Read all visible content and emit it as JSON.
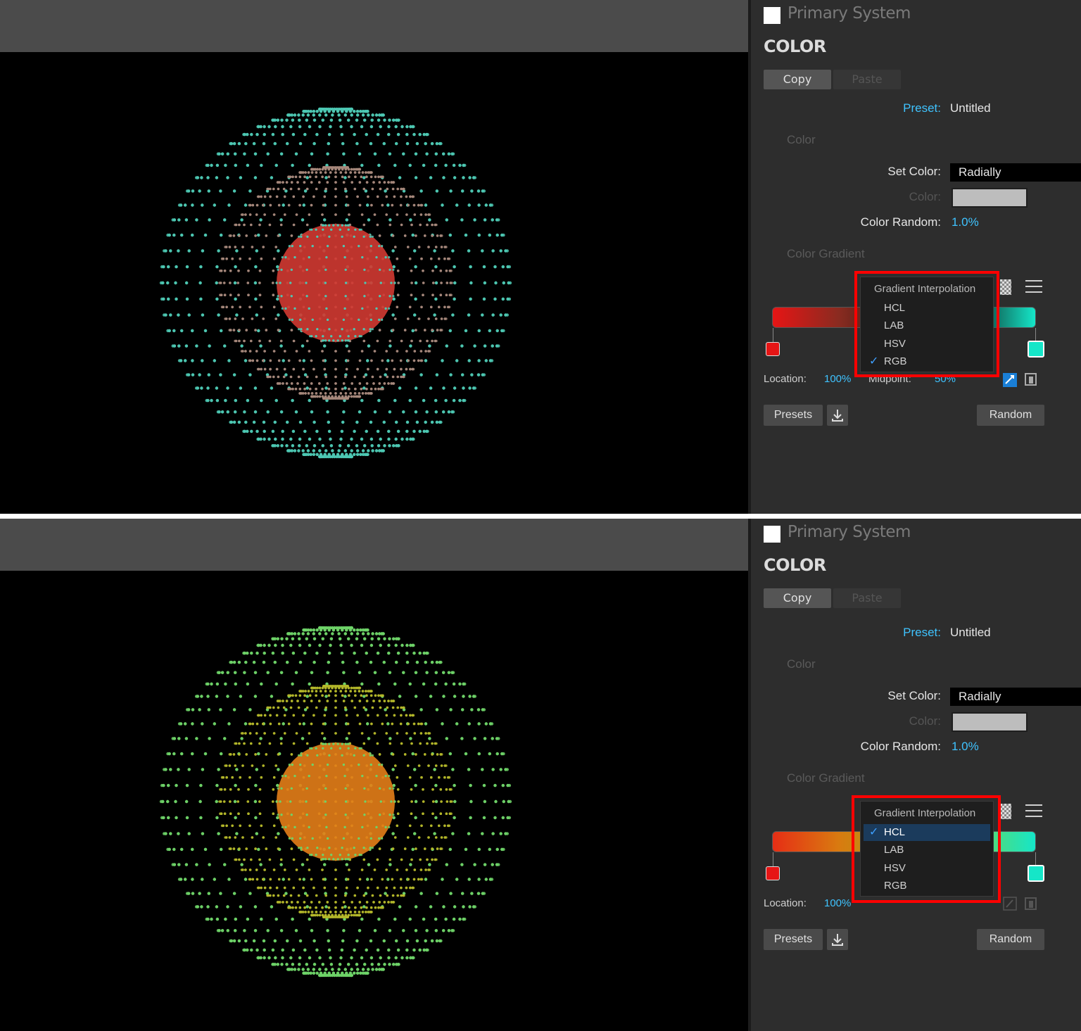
{
  "panels": [
    {
      "system_title": "Primary System",
      "section_title": "COLOR",
      "copy_label": "Copy",
      "paste_label": "Paste",
      "preset_label": "Preset:",
      "preset_value": "Untitled",
      "color_group_title": "Color",
      "set_color_label": "Set Color:",
      "set_color_value": "Radially",
      "color_label": "Color:",
      "color_random_label": "Color Random:",
      "color_random_value": "1.0%",
      "gradient_group_title": "Color Gradient",
      "dropdown_title": "Gradient Interpolation",
      "interpolation_options": [
        "HCL",
        "LAB",
        "HSV",
        "RGB"
      ],
      "selected_interpolation": "RGB",
      "location_label": "Location:",
      "location_value": "100%",
      "midpoint_label": "Midpoint:",
      "midpoint_value": "50%",
      "presets_label": "Presets",
      "random_label": "Random",
      "gradient_colors": [
        "#e61515",
        "#8a2b20",
        "#2b1a16",
        "#0e2a26",
        "#15e6c8"
      ],
      "sphere_colors": {
        "outer": "#4ec9b4",
        "middle": "#a88a7c",
        "inner": "#d23a32"
      }
    },
    {
      "system_title": "Primary System",
      "section_title": "COLOR",
      "copy_label": "Copy",
      "paste_label": "Paste",
      "preset_label": "Preset:",
      "preset_value": "Untitled",
      "color_group_title": "Color",
      "set_color_label": "Set Color:",
      "set_color_value": "Radially",
      "color_label": "Color:",
      "color_random_label": "Color Random:",
      "color_random_value": "1.0%",
      "gradient_group_title": "Color Gradient",
      "dropdown_title": "Gradient Interpolation",
      "interpolation_options": [
        "HCL",
        "LAB",
        "HSV",
        "RGB"
      ],
      "selected_interpolation": "HCL",
      "location_label": "Location:",
      "location_value": "100%",
      "midpoint_label": "",
      "midpoint_value": "",
      "presets_label": "Presets",
      "random_label": "Random",
      "gradient_colors": [
        "#e62e15",
        "#d97a10",
        "#a7a414",
        "#6cd55a",
        "#15e6c8"
      ],
      "sphere_colors": {
        "outer": "#6ed468",
        "middle": "#b5b82a",
        "inner": "#e47e18"
      }
    }
  ],
  "accent_color": "#3fc3ff",
  "highlight_color": "#ff0000",
  "icons": [
    "checkerboard-icon",
    "hamburger-menu-icon",
    "download-icon",
    "swap-stop-icon",
    "duplicate-stop-icon",
    "checkmark-icon"
  ]
}
